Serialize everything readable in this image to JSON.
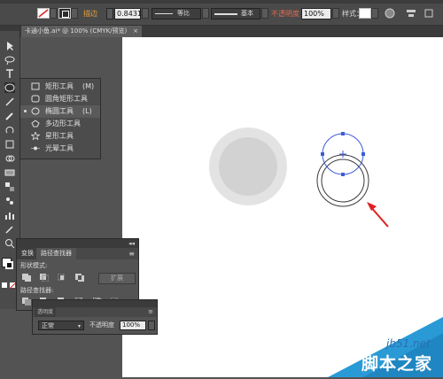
{
  "control_bar": {
    "stroke_weight": "0.8431",
    "stroke_label": "描边",
    "profile1_label": "等比",
    "profile2_label": "基本",
    "opacity_label": "不透明度",
    "opacity_value": "100%",
    "style_label": "样式："
  },
  "document_tab": {
    "title": "卡通小鱼.ai* @ 100% (CMYK/预览)",
    "close": "×"
  },
  "tools": [
    "selection-tool",
    "direct-selection-tool",
    "lasso-tool",
    "type-tool",
    "ellipse-tool",
    "pen-tool",
    "pencil-tool",
    "rotate-tool",
    "warp-tool",
    "free-transform-tool",
    "shape-builder-tool",
    "gradient-tool",
    "blend-tool",
    "symbol-sprayer-tool",
    "column-graph-tool",
    "eyedropper-tool",
    "zoom-tool"
  ],
  "flyout": {
    "items": [
      {
        "label": "矩形工具",
        "key": "(M)",
        "icon": "rectangle-icon"
      },
      {
        "label": "圆角矩形工具",
        "key": "",
        "icon": "rounded-rectangle-icon"
      },
      {
        "label": "椭圆工具",
        "key": "(L)",
        "icon": "ellipse-icon",
        "active": true
      },
      {
        "label": "多边形工具",
        "key": "",
        "icon": "polygon-icon"
      },
      {
        "label": "星形工具",
        "key": "",
        "icon": "star-icon"
      },
      {
        "label": "光晕工具",
        "key": "",
        "icon": "flare-icon"
      }
    ]
  },
  "pathfinder": {
    "tab1": "变换",
    "tab2": "路径查找器",
    "shape_modes_label": "形状模式:",
    "expand_label": "扩展",
    "pathfinders_label": "路径查找器:"
  },
  "transparency": {
    "tab": "透明度",
    "mode": "正常",
    "opacity_label": "不透明度",
    "opacity_value": "100%"
  },
  "watermark": {
    "url": "jb51.net",
    "name": "脚本之家"
  },
  "colors": {
    "circle_outer": "#e3e3e3",
    "circle_inner": "#d2d2d2",
    "selection_blue": "#3d5bd9",
    "arrow_red": "#e02020"
  }
}
